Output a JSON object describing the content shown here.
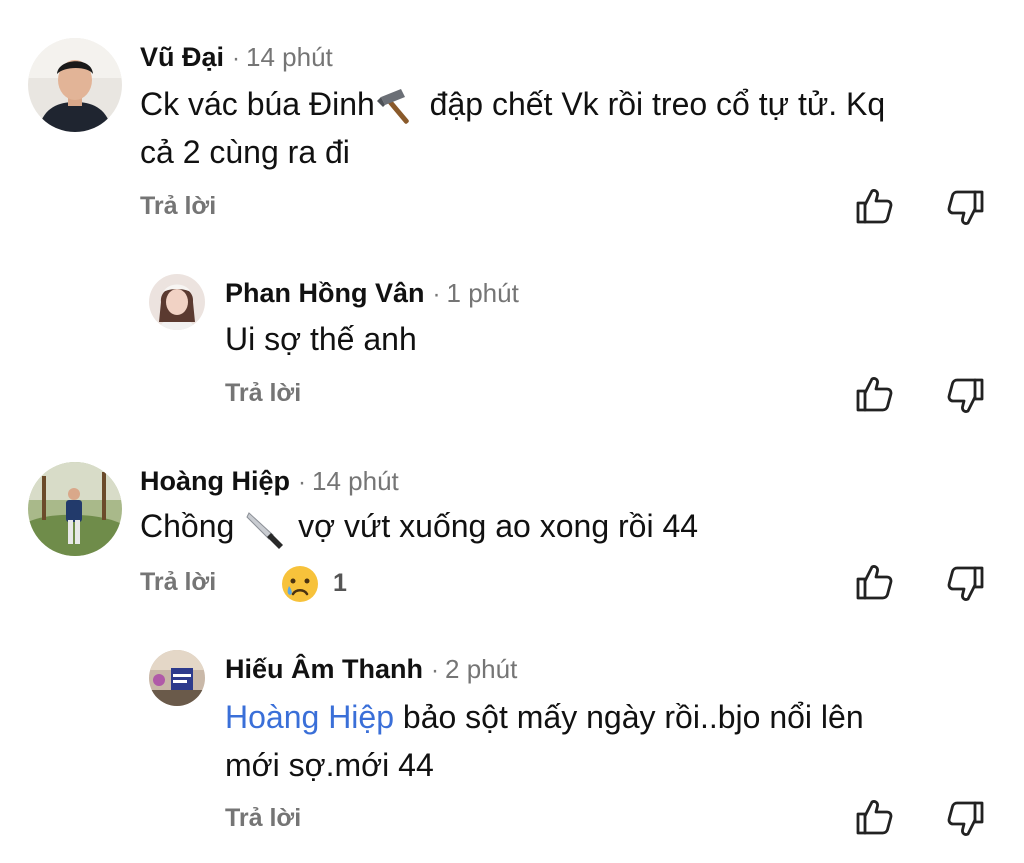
{
  "comments": [
    {
      "name": "Vũ Đại",
      "separator": "·",
      "time": "14 phút",
      "text_part1": "Ck vác búa Đinh",
      "emoji": "hammer-emoji",
      "text_part2": " đập chết Vk rồi treo cổ tự tử. Kq",
      "text_line2": "cả 2 cùng ra đi",
      "reply_label": "Trả lời"
    },
    {
      "name": "Phan Hồng Vân",
      "separator": "·",
      "time": "1 phút",
      "text": "Ui sợ thế anh",
      "reply_label": "Trả lời"
    },
    {
      "name": "Hoàng Hiệp",
      "separator": "·",
      "time": "14 phút",
      "text_part1": "Chồng ",
      "emoji": "knife-emoji",
      "text_part2": " vợ vứt xuống ao xong rồi 44",
      "reply_label": "Trả lời",
      "reaction_emoji": "crying-face-emoji",
      "reaction_count": "1"
    },
    {
      "name": "Hiếu Âm Thanh",
      "separator": "·",
      "time": "2 phút",
      "mention": "Hoàng Hiệp",
      "text_part1": " bảo sột mấy ngày rồi..bjo nổi lên",
      "text_line2": "mới sợ.mới 44",
      "reply_label": "Trả lời"
    }
  ],
  "icons": {
    "like": "thumbs-up-icon",
    "dislike": "thumbs-down-icon"
  },
  "colors": {
    "text": "#111111",
    "muted": "#757575",
    "mention": "#3a6fd8"
  }
}
